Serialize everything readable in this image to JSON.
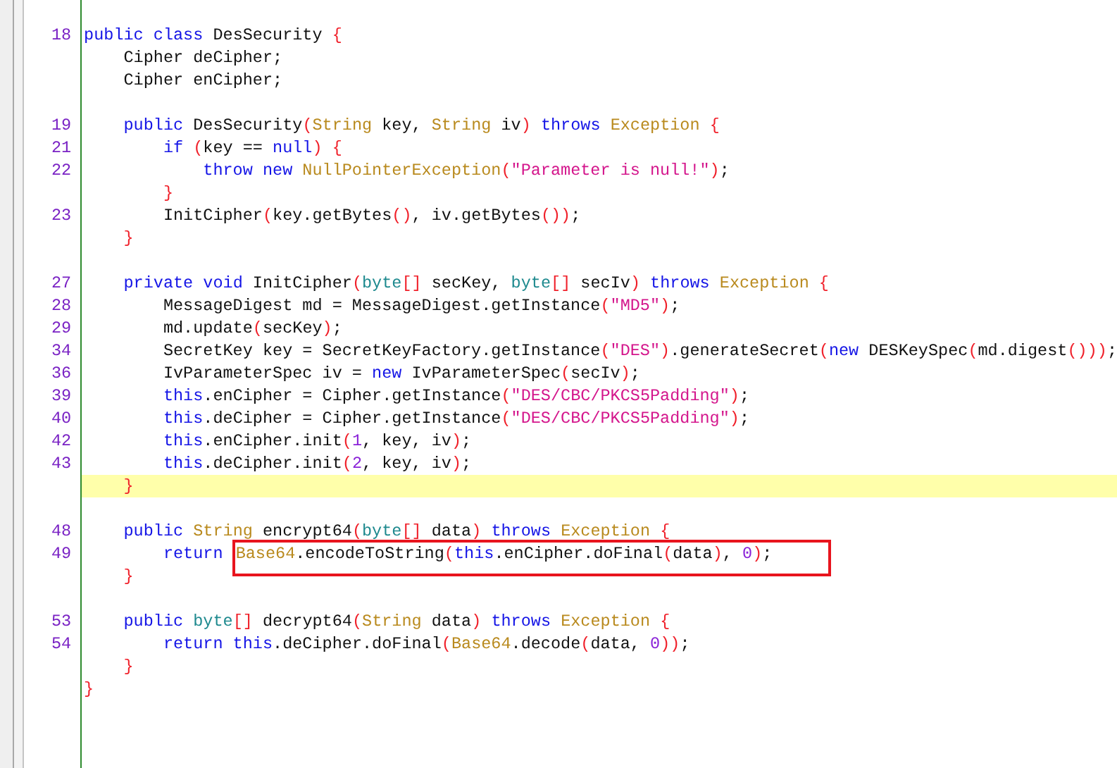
{
  "editor": {
    "lines": [
      {
        "number": "18",
        "highlighted": false,
        "tokens": [
          {
            "kind": "kw",
            "text": "public class "
          },
          {
            "kind": "plain",
            "text": "DesSecurity "
          },
          {
            "kind": "punc",
            "text": "{"
          }
        ],
        "children": [
          {
            "highlighted": false,
            "tokens": [
              {
                "kind": "plain",
                "text": "Cipher deCipher;"
              }
            ]
          },
          {
            "highlighted": false,
            "tokens": [
              {
                "kind": "plain",
                "text": "Cipher enCipher;"
              }
            ]
          },
          {
            "highlighted": false
          },
          {
            "number": "19",
            "highlighted": false,
            "tokens": [
              {
                "kind": "kw",
                "text": "public "
              },
              {
                "kind": "plain",
                "text": "DesSecurity"
              },
              {
                "kind": "punc",
                "text": "("
              },
              {
                "kind": "type",
                "text": "String "
              },
              {
                "kind": "plain",
                "text": "key, "
              },
              {
                "kind": "type",
                "text": "String "
              },
              {
                "kind": "plain",
                "text": "iv"
              },
              {
                "kind": "punc",
                "text": ") "
              },
              {
                "kind": "kw",
                "text": "throws "
              },
              {
                "kind": "type",
                "text": "Exception "
              },
              {
                "kind": "punc",
                "text": "{"
              }
            ],
            "children": [
              {
                "number": "21",
                "highlighted": false,
                "tokens": [
                  {
                    "kind": "kw",
                    "text": "if "
                  },
                  {
                    "kind": "punc",
                    "text": "("
                  },
                  {
                    "kind": "plain",
                    "text": "key == "
                  },
                  {
                    "kind": "kw",
                    "text": "null"
                  },
                  {
                    "kind": "punc",
                    "text": ") "
                  },
                  {
                    "kind": "punc",
                    "text": "{"
                  }
                ],
                "children": [
                  {
                    "number": "22",
                    "highlighted": false,
                    "tokens": [
                      {
                        "kind": "kw",
                        "text": "throw new "
                      },
                      {
                        "kind": "type",
                        "text": "NullPointerException"
                      },
                      {
                        "kind": "punc",
                        "text": "("
                      },
                      {
                        "kind": "str",
                        "text": "\"Parameter is null!\""
                      },
                      {
                        "kind": "punc",
                        "text": ")"
                      },
                      {
                        "kind": "plain",
                        "text": ";"
                      }
                    ]
                  }
                ]
              },
              {
                "highlighted": false,
                "tokens": [
                  {
                    "kind": "punc",
                    "text": "}"
                  }
                ]
              },
              {
                "number": "23",
                "highlighted": false,
                "tokens": [
                  {
                    "kind": "plain",
                    "text": "InitCipher"
                  },
                  {
                    "kind": "punc",
                    "text": "("
                  },
                  {
                    "kind": "plain",
                    "text": "key.getBytes"
                  },
                  {
                    "kind": "punc",
                    "text": "()"
                  },
                  {
                    "kind": "plain",
                    "text": ", iv.getBytes"
                  },
                  {
                    "kind": "punc",
                    "text": "())"
                  },
                  {
                    "kind": "plain",
                    "text": ";"
                  }
                ]
              }
            ]
          },
          {
            "highlighted": false,
            "tokens": [
              {
                "kind": "punc",
                "text": "}"
              }
            ]
          },
          {
            "highlighted": false
          },
          {
            "number": "27",
            "highlighted": false,
            "tokens": [
              {
                "kind": "kw",
                "text": "private void "
              },
              {
                "kind": "plain",
                "text": "InitCipher"
              },
              {
                "kind": "punc",
                "text": "("
              },
              {
                "kind": "prim",
                "text": "byte"
              },
              {
                "kind": "punc",
                "text": "[]"
              },
              {
                "kind": "plain",
                "text": " secKey, "
              },
              {
                "kind": "prim",
                "text": "byte"
              },
              {
                "kind": "punc",
                "text": "[]"
              },
              {
                "kind": "plain",
                "text": " secIv"
              },
              {
                "kind": "punc",
                "text": ") "
              },
              {
                "kind": "kw",
                "text": "throws "
              },
              {
                "kind": "type",
                "text": "Exception "
              },
              {
                "kind": "punc",
                "text": "{"
              }
            ],
            "children": [
              {
                "number": "28",
                "highlighted": false,
                "tokens": [
                  {
                    "kind": "plain",
                    "text": "MessageDigest md = MessageDigest.getInstance"
                  },
                  {
                    "kind": "punc",
                    "text": "("
                  },
                  {
                    "kind": "str",
                    "text": "\"MD5\""
                  },
                  {
                    "kind": "punc",
                    "text": ")"
                  },
                  {
                    "kind": "plain",
                    "text": ";"
                  }
                ]
              },
              {
                "number": "29",
                "highlighted": false,
                "tokens": [
                  {
                    "kind": "plain",
                    "text": "md.update"
                  },
                  {
                    "kind": "punc",
                    "text": "("
                  },
                  {
                    "kind": "plain",
                    "text": "secKey"
                  },
                  {
                    "kind": "punc",
                    "text": ")"
                  },
                  {
                    "kind": "plain",
                    "text": ";"
                  }
                ]
              },
              {
                "number": "34",
                "highlighted": false,
                "tokens": [
                  {
                    "kind": "plain",
                    "text": "SecretKey key = SecretKeyFactory.getInstance"
                  },
                  {
                    "kind": "punc",
                    "text": "("
                  },
                  {
                    "kind": "str",
                    "text": "\"DES\""
                  },
                  {
                    "kind": "punc",
                    "text": ")"
                  },
                  {
                    "kind": "plain",
                    "text": ".generateSecret"
                  },
                  {
                    "kind": "punc",
                    "text": "("
                  },
                  {
                    "kind": "kw",
                    "text": "new "
                  },
                  {
                    "kind": "plain",
                    "text": "DESKeySpec"
                  },
                  {
                    "kind": "punc",
                    "text": "("
                  },
                  {
                    "kind": "plain",
                    "text": "md.digest"
                  },
                  {
                    "kind": "punc",
                    "text": "()))"
                  },
                  {
                    "kind": "plain",
                    "text": ";"
                  }
                ]
              },
              {
                "number": "36",
                "highlighted": false,
                "tokens": [
                  {
                    "kind": "plain",
                    "text": "IvParameterSpec iv = "
                  },
                  {
                    "kind": "kw",
                    "text": "new "
                  },
                  {
                    "kind": "plain",
                    "text": "IvParameterSpec"
                  },
                  {
                    "kind": "punc",
                    "text": "("
                  },
                  {
                    "kind": "plain",
                    "text": "secIv"
                  },
                  {
                    "kind": "punc",
                    "text": ")"
                  },
                  {
                    "kind": "plain",
                    "text": ";"
                  }
                ]
              },
              {
                "number": "39",
                "highlighted": false,
                "tokens": [
                  {
                    "kind": "kw",
                    "text": "this"
                  },
                  {
                    "kind": "plain",
                    "text": ".enCipher = Cipher.getInstance"
                  },
                  {
                    "kind": "punc",
                    "text": "("
                  },
                  {
                    "kind": "str",
                    "text": "\"DES/CBC/PKCS5Padding\""
                  },
                  {
                    "kind": "punc",
                    "text": ")"
                  },
                  {
                    "kind": "plain",
                    "text": ";"
                  }
                ]
              },
              {
                "number": "40",
                "highlighted": false,
                "tokens": [
                  {
                    "kind": "kw",
                    "text": "this"
                  },
                  {
                    "kind": "plain",
                    "text": ".deCipher = Cipher.getInstance"
                  },
                  {
                    "kind": "punc",
                    "text": "("
                  },
                  {
                    "kind": "str",
                    "text": "\"DES/CBC/PKCS5Padding\""
                  },
                  {
                    "kind": "punc",
                    "text": ")"
                  },
                  {
                    "kind": "plain",
                    "text": ";"
                  }
                ]
              },
              {
                "number": "42",
                "highlighted": false,
                "tokens": [
                  {
                    "kind": "kw",
                    "text": "this"
                  },
                  {
                    "kind": "plain",
                    "text": ".enCipher.init"
                  },
                  {
                    "kind": "punc",
                    "text": "("
                  },
                  {
                    "kind": "num",
                    "text": "1"
                  },
                  {
                    "kind": "plain",
                    "text": ", key, iv"
                  },
                  {
                    "kind": "punc",
                    "text": ")"
                  },
                  {
                    "kind": "plain",
                    "text": ";"
                  }
                ]
              },
              {
                "number": "43",
                "highlighted": false,
                "tokens": [
                  {
                    "kind": "kw",
                    "text": "this"
                  },
                  {
                    "kind": "plain",
                    "text": ".deCipher.init"
                  },
                  {
                    "kind": "punc",
                    "text": "("
                  },
                  {
                    "kind": "num",
                    "text": "2"
                  },
                  {
                    "kind": "plain",
                    "text": ", key, iv"
                  },
                  {
                    "kind": "punc",
                    "text": ")"
                  },
                  {
                    "kind": "plain",
                    "text": ";"
                  }
                ]
              }
            ]
          },
          {
            "highlighted": true,
            "tokens": [
              {
                "kind": "punc",
                "text": "}"
              }
            ]
          },
          {
            "highlighted": false
          },
          {
            "number": "48",
            "highlighted": false,
            "tokens": [
              {
                "kind": "kw",
                "text": "public "
              },
              {
                "kind": "type",
                "text": "String "
              },
              {
                "kind": "plain",
                "text": "encrypt64"
              },
              {
                "kind": "punc",
                "text": "("
              },
              {
                "kind": "prim",
                "text": "byte"
              },
              {
                "kind": "punc",
                "text": "[]"
              },
              {
                "kind": "plain",
                "text": " data"
              },
              {
                "kind": "punc",
                "text": ") "
              },
              {
                "kind": "kw",
                "text": "throws "
              },
              {
                "kind": "type",
                "text": "Exception "
              },
              {
                "kind": "punc",
                "text": "{"
              }
            ],
            "children": [
              {
                "number": "49",
                "highlighted": false,
                "tokens": [
                  {
                    "kind": "kw",
                    "text": "return "
                  }
                ],
                "boxed_tokens": [
                  {
                    "kind": "type",
                    "text": "Base64"
                  },
                  {
                    "kind": "plain",
                    "text": ".encodeToString"
                  },
                  {
                    "kind": "punc",
                    "text": "("
                  },
                  {
                    "kind": "kw",
                    "text": "this"
                  },
                  {
                    "kind": "plain",
                    "text": ".enCipher.doFinal"
                  },
                  {
                    "kind": "punc",
                    "text": "("
                  },
                  {
                    "kind": "plain",
                    "text": "data"
                  },
                  {
                    "kind": "punc",
                    "text": ")"
                  },
                  {
                    "kind": "plain",
                    "text": ", "
                  },
                  {
                    "kind": "num",
                    "text": "0"
                  },
                  {
                    "kind": "punc",
                    "text": ")"
                  },
                  {
                    "kind": "plain",
                    "text": ";"
                  }
                ]
              }
            ]
          },
          {
            "highlighted": false,
            "tokens": [
              {
                "kind": "punc",
                "text": "}"
              }
            ]
          },
          {
            "highlighted": false
          },
          {
            "number": "53",
            "highlighted": false,
            "tokens": [
              {
                "kind": "kw",
                "text": "public "
              },
              {
                "kind": "prim",
                "text": "byte"
              },
              {
                "kind": "punc",
                "text": "[]"
              },
              {
                "kind": "plain",
                "text": " decrypt64"
              },
              {
                "kind": "punc",
                "text": "("
              },
              {
                "kind": "type",
                "text": "String "
              },
              {
                "kind": "plain",
                "text": "data"
              },
              {
                "kind": "punc",
                "text": ") "
              },
              {
                "kind": "kw",
                "text": "throws "
              },
              {
                "kind": "type",
                "text": "Exception "
              },
              {
                "kind": "punc",
                "text": "{"
              }
            ],
            "children": [
              {
                "number": "54",
                "highlighted": false,
                "tokens": [
                  {
                    "kind": "kw",
                    "text": "return this"
                  },
                  {
                    "kind": "plain",
                    "text": ".deCipher.doFinal"
                  },
                  {
                    "kind": "punc",
                    "text": "("
                  },
                  {
                    "kind": "type",
                    "text": "Base64"
                  },
                  {
                    "kind": "plain",
                    "text": ".decode"
                  },
                  {
                    "kind": "punc",
                    "text": "("
                  },
                  {
                    "kind": "plain",
                    "text": "data, "
                  },
                  {
                    "kind": "num",
                    "text": "0"
                  },
                  {
                    "kind": "punc",
                    "text": "))"
                  },
                  {
                    "kind": "plain",
                    "text": ";"
                  }
                ]
              }
            ]
          },
          {
            "highlighted": false,
            "tokens": [
              {
                "kind": "punc",
                "text": "}"
              }
            ]
          }
        ]
      },
      {
        "highlighted": false,
        "tokens": [
          {
            "kind": "punc",
            "text": "}"
          }
        ]
      }
    ]
  }
}
